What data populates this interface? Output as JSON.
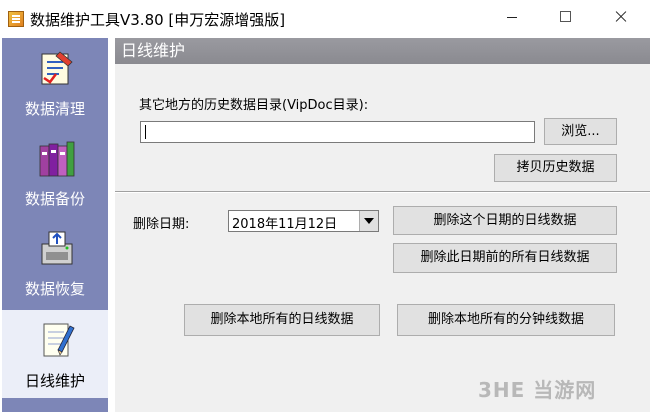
{
  "window": {
    "title": "数据维护工具V3.80 [申万宏源增强版]"
  },
  "sidebar": {
    "items": [
      {
        "label": "数据清理",
        "icon": "checklist-paper-icon",
        "active": false
      },
      {
        "label": "数据备份",
        "icon": "book-stack-icon",
        "active": false
      },
      {
        "label": "数据恢复",
        "icon": "disk-restore-icon",
        "active": false
      },
      {
        "label": "日线维护",
        "icon": "pencil-notepad-icon",
        "active": true
      }
    ]
  },
  "panel": {
    "header": "日线维护",
    "history_dir_label": "其它地方的历史数据目录(VipDoc目录):",
    "history_dir_value": "",
    "browse_button": "浏览...",
    "copy_button": "拷贝历史数据",
    "delete_date_label": "删除日期:",
    "delete_date_value": "2018年11月12日",
    "delete_this_date_button": "删除这个日期的日线数据",
    "delete_before_date_button": "删除此日期前的所有日线数据",
    "delete_all_daily_button": "删除本地所有的日线数据",
    "delete_all_minute_button": "删除本地所有的分钟线数据"
  },
  "watermark": "3HE 当游网",
  "colors": {
    "sidebar": "#7d86b7",
    "sidebar_active": "#ebeef8",
    "header": "#8f8f95",
    "panel": "#f0f0f0"
  }
}
